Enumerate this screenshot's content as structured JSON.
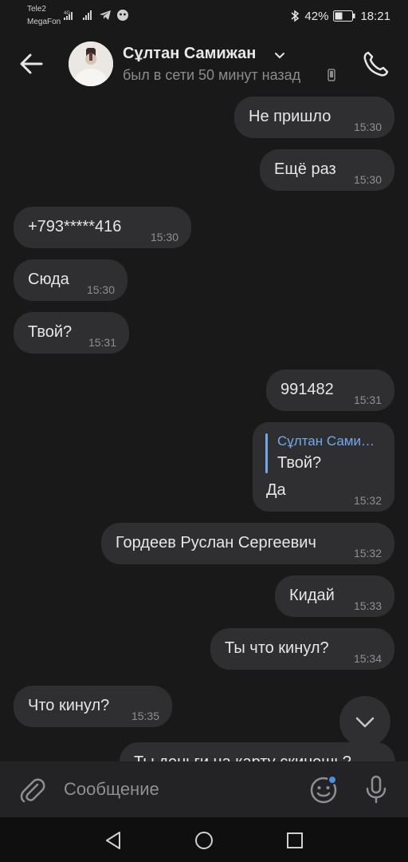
{
  "status_bar": {
    "carrier1": "Tele2",
    "carrier2": "MegaFon",
    "battery": "42%",
    "time": "18:21"
  },
  "header": {
    "contact_name": "Сұлтан Самижан",
    "status": "был в сети 50 минут назад"
  },
  "messages": [
    {
      "text": "Не пришло",
      "time": "15:30",
      "side": "out"
    },
    {
      "text": "Ещё раз",
      "time": "15:30",
      "side": "out"
    },
    {
      "text": "+793*****416",
      "time": "15:30",
      "side": "in"
    },
    {
      "text": "Сюда",
      "time": "15:30",
      "side": "in"
    },
    {
      "text": "Твой?",
      "time": "15:31",
      "side": "in"
    },
    {
      "text": "991482",
      "time": "15:31",
      "side": "out"
    },
    {
      "text": "Гордеев Руслан Сергеевич",
      "time": "15:32",
      "side": "out"
    },
    {
      "text": "Кидай",
      "time": "15:33",
      "side": "out"
    },
    {
      "text": "Ты что кинул?",
      "time": "15:34",
      "side": "out"
    },
    {
      "text": "Что кинул?",
      "time": "15:35",
      "side": "in"
    }
  ],
  "reply_message": {
    "quoted_name": "Сұлтан Самижан",
    "quoted_text": "Твой?",
    "text": "Да",
    "time": "15:32"
  },
  "partial_message": {
    "text": "Ты деньги на карту скинешь?"
  },
  "composer": {
    "placeholder": "Сообщение"
  },
  "colors": {
    "background": "#19191a",
    "bubble": "#2f2f31",
    "accent": "#71aaeb",
    "unread_dot": "#4a90e2"
  },
  "icons": {
    "back": "arrow-left-icon",
    "call": "phone-icon",
    "attach": "paperclip-icon",
    "emoji": "smile-icon",
    "mic": "microphone-icon",
    "scroll": "chevron-down-icon"
  }
}
